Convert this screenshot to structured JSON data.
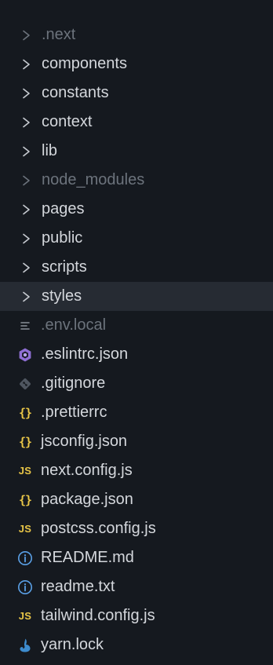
{
  "explorer": {
    "folders": [
      {
        "name": ".next",
        "dimmed": true
      },
      {
        "name": "components",
        "dimmed": false
      },
      {
        "name": "constants",
        "dimmed": false
      },
      {
        "name": "context",
        "dimmed": false
      },
      {
        "name": "lib",
        "dimmed": false
      },
      {
        "name": "node_modules",
        "dimmed": true
      },
      {
        "name": "pages",
        "dimmed": false
      },
      {
        "name": "public",
        "dimmed": false
      },
      {
        "name": "scripts",
        "dimmed": false
      },
      {
        "name": "styles",
        "dimmed": false,
        "selected": true
      }
    ],
    "files": [
      {
        "name": ".env.local",
        "icon": "lines-icon",
        "dimmed": true
      },
      {
        "name": ".eslintrc.json",
        "icon": "eslint-icon",
        "dimmed": false
      },
      {
        "name": ".gitignore",
        "icon": "git-icon",
        "dimmed": false
      },
      {
        "name": ".prettierrc",
        "icon": "json-braces-icon",
        "dimmed": false
      },
      {
        "name": "jsconfig.json",
        "icon": "json-braces-icon",
        "dimmed": false
      },
      {
        "name": "next.config.js",
        "icon": "js-icon",
        "dimmed": false
      },
      {
        "name": "package.json",
        "icon": "json-braces-icon",
        "dimmed": false
      },
      {
        "name": "postcss.config.js",
        "icon": "js-icon",
        "dimmed": false
      },
      {
        "name": "README.md",
        "icon": "info-icon",
        "dimmed": false
      },
      {
        "name": "readme.txt",
        "icon": "info-icon",
        "dimmed": false
      },
      {
        "name": "tailwind.config.js",
        "icon": "js-icon",
        "dimmed": false
      },
      {
        "name": "yarn.lock",
        "icon": "yarn-icon",
        "dimmed": false
      }
    ]
  },
  "icons": {
    "js_badge": "JS",
    "json_braces": "{}"
  },
  "colors": {
    "background": "#15191f",
    "selected_row": "#262b33",
    "text": "#d4d7dc",
    "text_dimmed": "#6c737c",
    "js_yellow": "#e8c547",
    "eslint_purple": "#8f6fd4",
    "git_gray": "#4f5660",
    "info_blue": "#5aa0e6",
    "yarn_blue": "#3d8ccf"
  }
}
